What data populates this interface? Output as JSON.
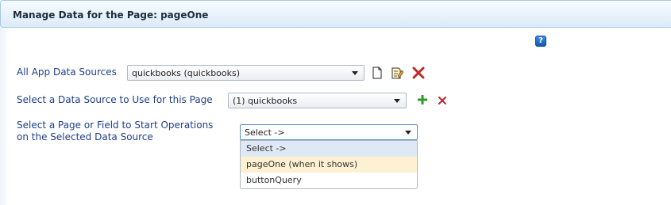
{
  "header": {
    "title": "Manage Data for the Page: pageOne"
  },
  "help": {
    "glyph": "?"
  },
  "rows": {
    "app_sources": {
      "label": "All App Data Sources",
      "selected": "quickbooks (quickbooks)",
      "icons": [
        "new-document-icon",
        "edit-document-icon",
        "delete-icon"
      ]
    },
    "use_source": {
      "label": "Select a Data Source to Use for this Page",
      "selected": "(1) quickbooks",
      "icons": [
        "add-icon",
        "remove-icon"
      ]
    },
    "start_ops": {
      "label_line1": "Select a Page or Field to Start Operations",
      "label_line2": "on the Selected Data Source",
      "selected": "Select ->",
      "options": [
        "Select ->",
        "pageOne (when it shows)",
        "buttonQuery"
      ]
    }
  },
  "colors": {
    "label": "#1f3f8a",
    "add": "#2e9a2e",
    "delete": "#c0282e",
    "hover_option": "#fdf1d2"
  }
}
